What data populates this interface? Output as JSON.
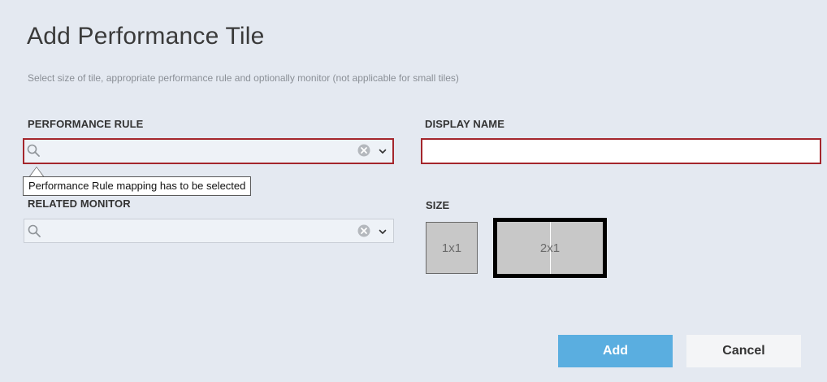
{
  "dialog": {
    "title": "Add Performance Tile",
    "subtitle": "Select size of tile, appropriate performance rule and optionally monitor (not applicable for small tiles)"
  },
  "performance_rule": {
    "label": "PERFORMANCE RULE",
    "value": "",
    "validation_message": "Performance Rule mapping has to be selected"
  },
  "display_name": {
    "label": "DISPLAY NAME",
    "value": ""
  },
  "related_monitor": {
    "label": "RELATED MONITOR",
    "value": ""
  },
  "size": {
    "label": "SIZE",
    "options": [
      "1x1",
      "2x1"
    ],
    "selected": "2x1"
  },
  "buttons": {
    "add": "Add",
    "cancel": "Cancel"
  },
  "colors": {
    "background": "#e4e9f1",
    "error_border": "#a4262c",
    "primary_button": "#5aaee0",
    "secondary_button": "#f4f5f7",
    "tile_fill": "#c8c8c8"
  },
  "icons": {
    "search": "search-icon",
    "clear": "clear-circle-icon",
    "dropdown": "chevron-down-icon"
  }
}
